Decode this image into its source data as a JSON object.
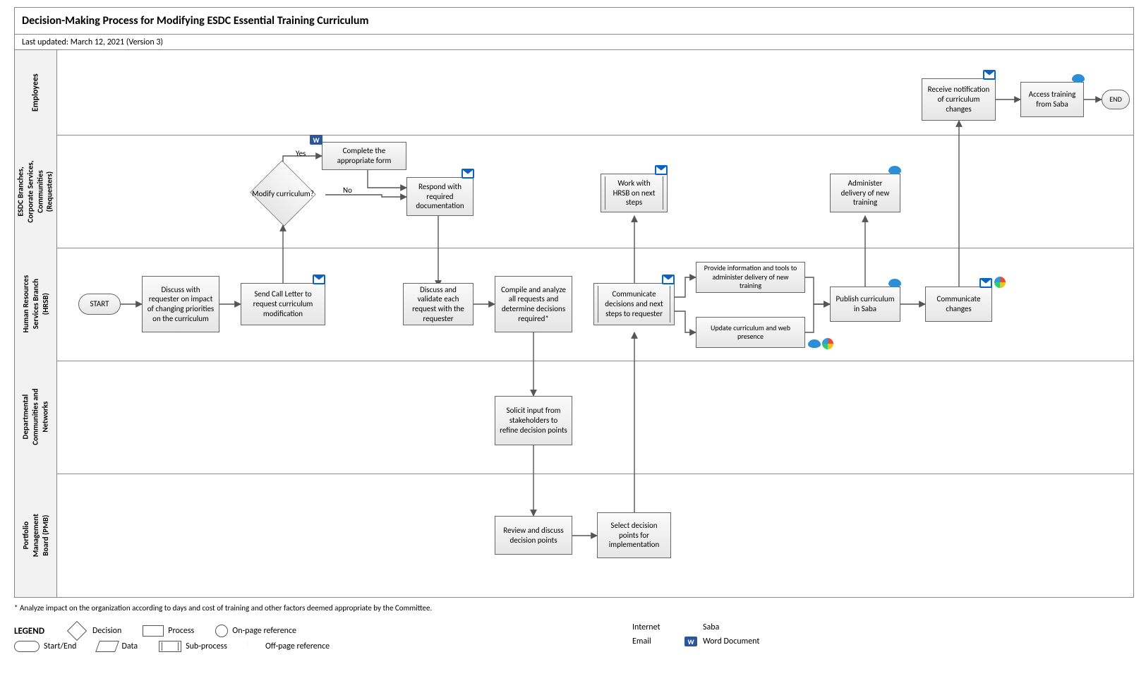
{
  "title": "Decision-Making Process for Modifying ESDC Essential Training Curriculum",
  "last_updated": "Last updated: March 12, 2021 (Version 3)",
  "lanes": {
    "employees": "Employees",
    "requesters": "ESDC Branches,\nCorporate Services,\nCommunities\n(Requesters)",
    "hrsb": "Human Resources\nServices Branch\n(HRSB)",
    "dcn": "Departmental\nCommunities and\nNetworks",
    "pmb": "Portfolio\nManagement\nBoard (PMB)"
  },
  "nodes": {
    "start": "START",
    "end": "END",
    "discuss_impact": "Discuss with requester on impact of changing priorities on the curriculum",
    "send_call": "Send Call Letter to request curriculum modification",
    "modify_q": "Modify curriculum?",
    "complete_form": "Complete the appropriate form",
    "respond_docs": "Respond with required documentation",
    "discuss_validate": "Discuss and validate each request with the requester",
    "compile": "Compile and analyze all requests and determine decisions required*",
    "solicit": "Solicit input from stakeholders to refine decision points",
    "review_pmb": "Review and discuss decision points",
    "select_pmb": "Select decision points for implementation",
    "communicate_req": "Communicate decisions and next steps to requester",
    "work_hrsb": "Work with HRSB on next steps",
    "provide_info": "Provide information and tools to administer delivery of new training",
    "update_web": "Update curriculum and web presence",
    "admin_delivery": "Administer delivery of new training",
    "publish": "Publish curriculum in Saba",
    "comm_changes": "Communicate changes",
    "receive_notif": "Receive notification of curriculum changes",
    "access_saba": "Access training from Saba"
  },
  "edges": {
    "yes": "Yes",
    "no": "No"
  },
  "footnote": "* Analyze impact on the organization according to days and cost of training and other factors deemed appropriate by the Committee.",
  "legend": {
    "title": "LEGEND",
    "decision": "Decision",
    "process": "Process",
    "onpage": "On-page reference",
    "startend": "Start/End",
    "data": "Data",
    "subprocess": "Sub-process",
    "offpage": "Off-page reference",
    "internet": "Internet",
    "saba": "Saba",
    "email": "Email",
    "word": "Word Document"
  }
}
